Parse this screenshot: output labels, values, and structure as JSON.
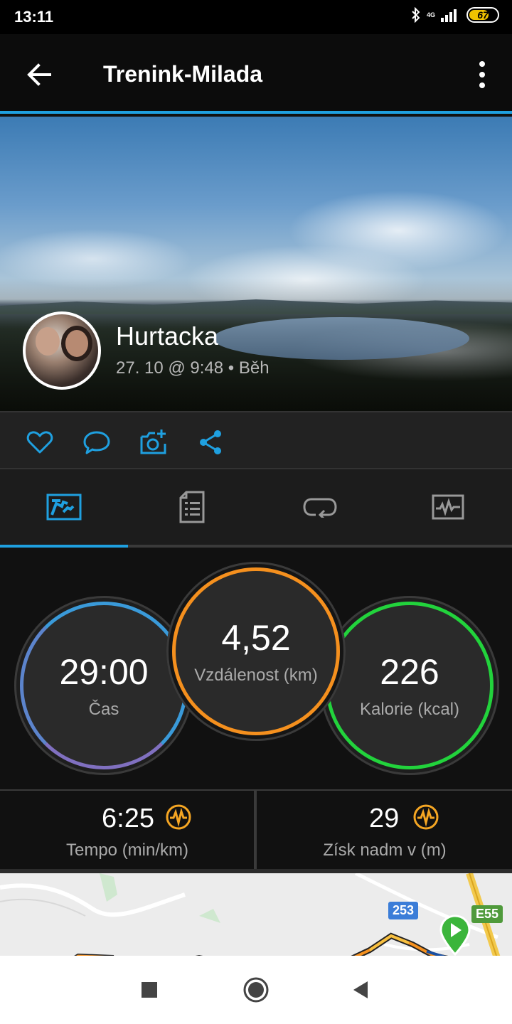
{
  "status_bar": {
    "time": "13:11",
    "network": "4G",
    "battery_level": "67"
  },
  "app_bar": {
    "title": "Trenink-Milada"
  },
  "hero": {
    "name": "Hurtacka",
    "subtitle": "27. 10 @ 9:48 • Běh"
  },
  "actions": [
    "like-icon",
    "comment-icon",
    "add-photo-icon",
    "share-icon"
  ],
  "tabs": [
    {
      "icon": "overview-icon",
      "active": true
    },
    {
      "icon": "details-list-icon",
      "active": false
    },
    {
      "icon": "laps-icon",
      "active": false
    },
    {
      "icon": "chart-icon",
      "active": false
    }
  ],
  "stats": {
    "time": {
      "value": "29:00",
      "label": "Čas"
    },
    "distance": {
      "value": "4,52",
      "label": "Vzdálenost (km)"
    },
    "calories": {
      "value": "226",
      "label": "Kalorie (kcal)"
    }
  },
  "metrics": {
    "pace": {
      "value": "6:25",
      "label": "Tempo (min/km)"
    },
    "elevation": {
      "value": "29",
      "label": "Získ nadm v (m)"
    }
  },
  "map": {
    "road_253": "253",
    "road_e55": "E55"
  },
  "colors": {
    "accent": "#1fa0e0",
    "time_ring": "#3a9ad9",
    "distance_ring": "#f5901e",
    "calories_ring": "#22d33c",
    "metric_icon": "#f5a623"
  }
}
